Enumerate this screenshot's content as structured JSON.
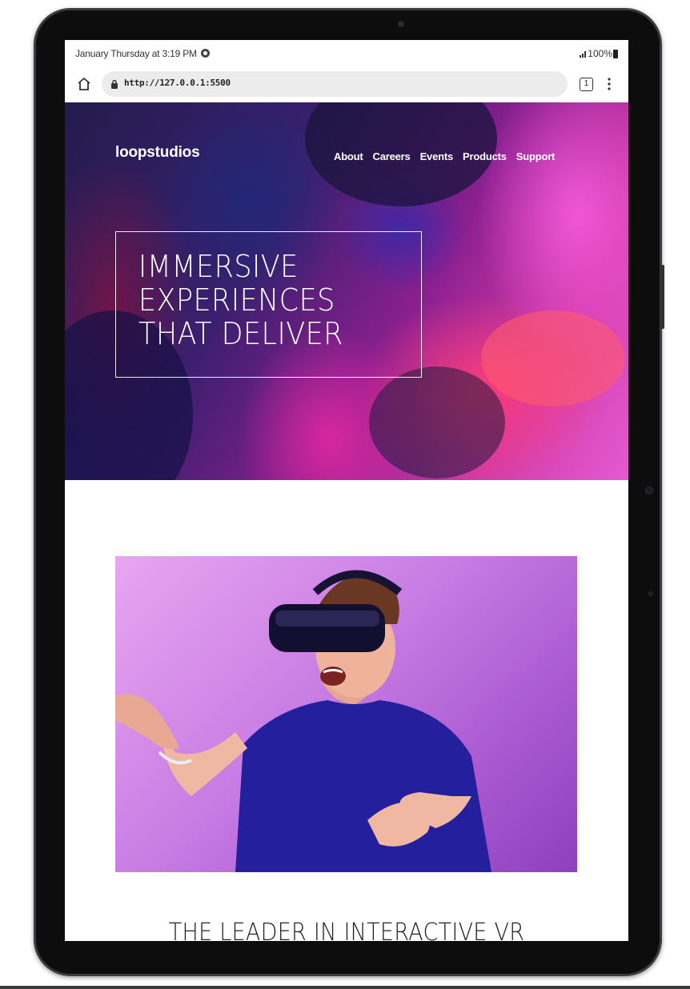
{
  "status_bar": {
    "time": "January Thursday at 3:19 PM",
    "battery": "100%"
  },
  "browser": {
    "url": "http://127.0.0.1:5500",
    "tab_count": "1"
  },
  "site": {
    "logo": "loopstudios",
    "nav": [
      "About",
      "Careers",
      "Events",
      "Products",
      "Support"
    ],
    "hero_title": "IMMERSIVE EXPERIENCES THAT DELIVER",
    "section_title": "THE LEADER IN INTERACTIVE VR"
  }
}
